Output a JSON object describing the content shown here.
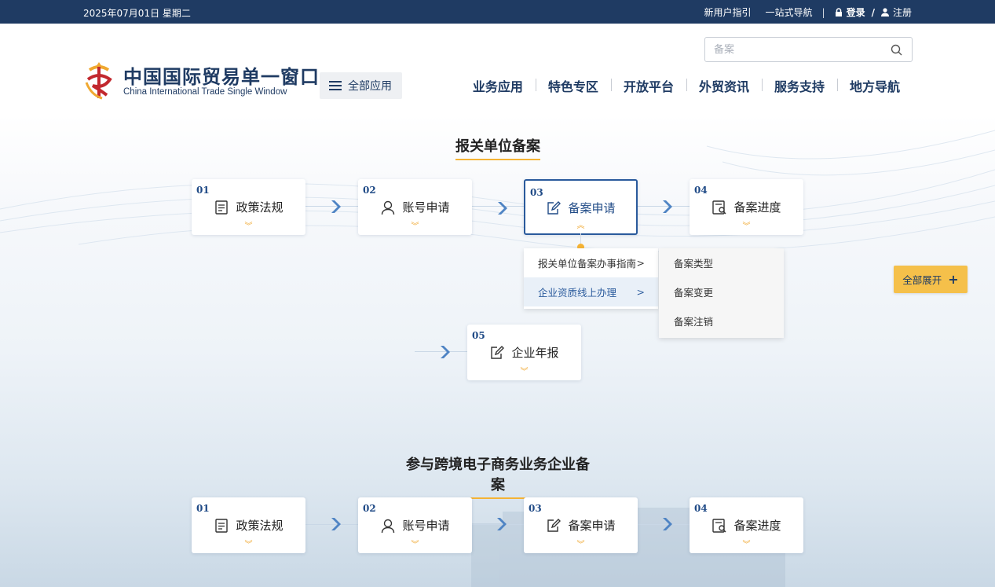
{
  "topbar": {
    "date": "2025年07月01日 星期二",
    "links": [
      "新用户指引",
      "一站式导航"
    ],
    "login": "登录",
    "slash": "/",
    "register": "注册"
  },
  "header": {
    "logo_cn": "中国国际贸易单一窗口",
    "logo_en": "China International Trade Single Window",
    "all_apps": "全部应用",
    "search_placeholder": "备案",
    "nav": [
      "业务应用",
      "特色专区",
      "开放平台",
      "外贸资讯",
      "服务支持",
      "地方导航"
    ]
  },
  "section1": {
    "title": "报关单位备案",
    "steps": [
      {
        "num": "01",
        "label": "政策法规",
        "icon": "document-icon"
      },
      {
        "num": "02",
        "label": "账号申请",
        "icon": "user-icon"
      },
      {
        "num": "03",
        "label": "备案申请",
        "icon": "edit-icon"
      },
      {
        "num": "04",
        "label": "备案进度",
        "icon": "search-document-icon"
      },
      {
        "num": "05",
        "label": "企业年报",
        "icon": "edit-icon"
      }
    ],
    "submenu": [
      {
        "label": "报关单位备案办事指南",
        "arrow": ">"
      },
      {
        "label": "企业资质线上办理",
        "arrow": ">"
      }
    ],
    "subsubmenu": [
      "备案类型",
      "备案变更",
      "备案注销"
    ]
  },
  "expand_all": "全部展开",
  "expand_plus": "+",
  "section2": {
    "title": "参与跨境电子商务业务企业备案",
    "steps": [
      {
        "num": "01",
        "label": "政策法规"
      },
      {
        "num": "02",
        "label": "账号申请"
      },
      {
        "num": "03",
        "label": "备案申请"
      },
      {
        "num": "04",
        "label": "备案进度"
      }
    ]
  },
  "colors": {
    "topbar": "#1f3b63",
    "accent": "#f5b335",
    "active": "#2a5a9c"
  }
}
